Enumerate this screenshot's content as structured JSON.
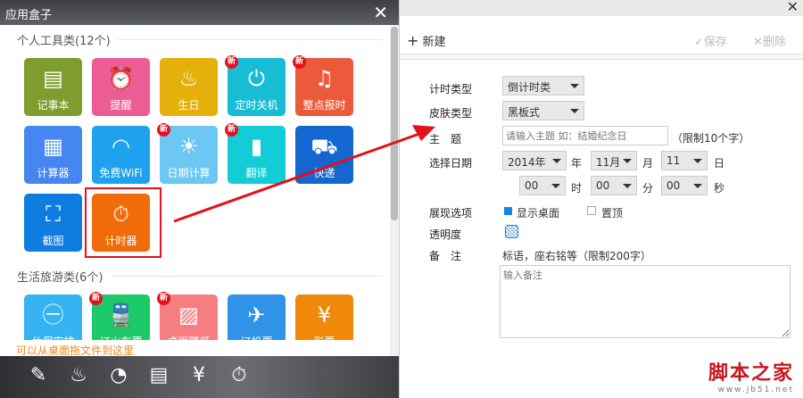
{
  "left": {
    "title": "应用盒子",
    "close": "✕",
    "section1": "个人工具类(12个)",
    "tiles1": [
      {
        "label": "记事本",
        "icon": "notepad-icon",
        "glyph": "▤",
        "color": "#7f9c2e",
        "new": false
      },
      {
        "label": "提醒",
        "icon": "alarm-icon",
        "glyph": "⏰",
        "color": "#ec5d94",
        "new": false
      },
      {
        "label": "生日",
        "icon": "cake-icon",
        "glyph": "♨",
        "color": "#e6b00c",
        "new": false
      },
      {
        "label": "定时关机",
        "icon": "power-icon",
        "glyph": "⏻",
        "color": "#18bcd4",
        "new": true
      },
      {
        "label": "整点报时",
        "icon": "bell-icon",
        "glyph": "♫",
        "color": "#ec5a3c",
        "new": true
      },
      {
        "label": "计算器",
        "icon": "calculator-icon",
        "glyph": "▦",
        "color": "#4586f0",
        "new": false
      },
      {
        "label": "免费WiFi",
        "icon": "wifi-icon",
        "glyph": "◠",
        "color": "#1ea2f0",
        "new": false
      },
      {
        "label": "日期计算",
        "icon": "date-calc-icon",
        "glyph": "☀",
        "color": "#6cc7f2",
        "new": true
      },
      {
        "label": "翻译",
        "icon": "book-icon",
        "glyph": "▮",
        "color": "#13cdd6",
        "new": true
      },
      {
        "label": "快递",
        "icon": "truck-icon",
        "glyph": "⛟",
        "color": "#1467d0",
        "new": false
      },
      {
        "label": "截图",
        "icon": "screenshot-icon",
        "glyph": "⛶",
        "color": "#0f7de0",
        "new": false
      },
      {
        "label": "计时器",
        "icon": "stopwatch-icon",
        "glyph": "⏱",
        "color": "#f06b0a",
        "new": false
      }
    ],
    "section2": "生活旅游类(6个)",
    "tiles2": [
      {
        "label": "休假安排",
        "icon": "holiday-icon",
        "glyph": "㊀",
        "color": "#36b4f2",
        "new": false
      },
      {
        "label": "订火车票",
        "icon": "train-icon",
        "glyph": "🚆",
        "color": "#1ec96a",
        "new": true
      },
      {
        "label": "桌面壁纸",
        "icon": "wallpaper-icon",
        "glyph": "▨",
        "color": "#f77e80",
        "new": true
      },
      {
        "label": "订机票",
        "icon": "plane-icon",
        "glyph": "✈",
        "color": "#2f93e8",
        "new": false
      },
      {
        "label": "彩票",
        "icon": "lottery-icon",
        "glyph": "¥",
        "color": "#f0880a",
        "new": false
      }
    ],
    "new_badge": "新",
    "hint": "可以从桌面拖文件到这里",
    "dock": [
      {
        "icon": "edit-icon",
        "glyph": "✎"
      },
      {
        "icon": "cake-icon",
        "glyph": "♨"
      },
      {
        "icon": "alarm-icon",
        "glyph": "◔"
      },
      {
        "icon": "notepad-icon",
        "glyph": "▤"
      },
      {
        "icon": "lottery-icon",
        "glyph": "¥"
      },
      {
        "icon": "stopwatch-icon",
        "glyph": "⏱"
      }
    ]
  },
  "right": {
    "close": "✕",
    "new": "新建",
    "save": "保存",
    "delete": "删除",
    "form": {
      "timer_type_label": "计时类型",
      "timer_type": "倒计时类",
      "skin_label": "皮肤类型",
      "skin": "黑板式",
      "subject_label": "主　题",
      "subject_placeholder": "请输入主题 如：结婚纪念日",
      "subject_limit": "（限制10个字）",
      "date_label": "选择日期",
      "year": "2014年",
      "year_unit": "年",
      "month": "11月",
      "month_unit": "月",
      "day": "11",
      "day_unit": "日",
      "hour": "00",
      "hour_unit": "时",
      "minute": "00",
      "minute_unit": "分",
      "second": "00",
      "second_unit": "秒",
      "display_label": "展现选项",
      "show_desktop": "显示桌面",
      "pin_top": "置顶",
      "opacity_label": "透明度",
      "note_label": "备　注",
      "note_hint": "标语，座右铭等（限制200字）",
      "note_placeholder": "输入备注"
    }
  },
  "watermark": {
    "name": "脚本之家",
    "url": "www.jb51.net"
  }
}
